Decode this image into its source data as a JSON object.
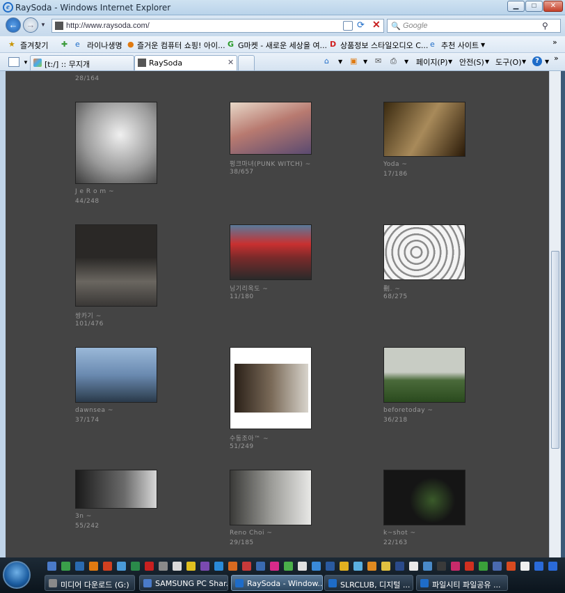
{
  "window": {
    "title": "RaySoda - Windows Internet Explorer"
  },
  "address": {
    "url": "http://www.raysoda.com/",
    "search_placeholder": "Google"
  },
  "favorites": {
    "label": "즐겨찾기",
    "items": [
      "라이나생명",
      "즐거운 컴퓨터 쇼핑! 아이...",
      "G마켓 - 새로운 세상을 여...",
      "상품정보 스타일오디오 C...",
      "추천 사이트"
    ]
  },
  "tabs": [
    {
      "label": "[t:/] :: 무지개"
    },
    {
      "label": "RaySoda"
    }
  ],
  "tools": {
    "page": "페이지(P)",
    "safety": "안전(S)",
    "tools": "도구(O)"
  },
  "page": {
    "top_count": "28/164",
    "photos": [
      {
        "name": "J e R o m ~",
        "count": "44/248",
        "color": "#d8d8d8"
      },
      {
        "name": "펑크마녀(PUNK WITCH) ~",
        "count": "38/657",
        "color": "#b87a70"
      },
      {
        "name": "Yoda ~",
        "count": "17/186",
        "color": "#8a6a3a"
      },
      {
        "name": "쌍카기 ~",
        "count": "101/476",
        "color": "#3a3836"
      },
      {
        "name": "닝기리옥도 ~",
        "count": "11/180",
        "color": "#7a2a2a"
      },
      {
        "name": "刪. ~",
        "count": "68/275",
        "color": "#c8c8c8"
      },
      {
        "name": "dawnsea ~",
        "count": "37/174",
        "color": "#6a8ab0"
      },
      {
        "name": "수동조아™ ~",
        "count": "51/249",
        "color": "#ffffff"
      },
      {
        "name": "beforetoday ~",
        "count": "36/218",
        "color": "#4a6a3a"
      },
      {
        "name": "3n ~",
        "count": "55/242",
        "color": "#2a2a2a"
      },
      {
        "name": "Reno Choi ~",
        "count": "29/185",
        "color": "#9a9a96"
      },
      {
        "name": "k~shot ~",
        "count": "22/163",
        "color": "#151515"
      }
    ]
  },
  "taskbar": {
    "tasks": [
      {
        "label": "미디어 다운로드 (G:)"
      },
      {
        "label": "SAMSUNG PC Shar..."
      },
      {
        "label": "RaySoda - Window..."
      },
      {
        "label": "SLRCLUB, 디지털 ..."
      },
      {
        "label": "파일시티 파일공유 ..."
      }
    ]
  },
  "colors": {
    "content_bg": "#444444",
    "caption": "#9a9a9a",
    "taskbar": "#0b141c",
    "accent": "#1e6cc8"
  }
}
